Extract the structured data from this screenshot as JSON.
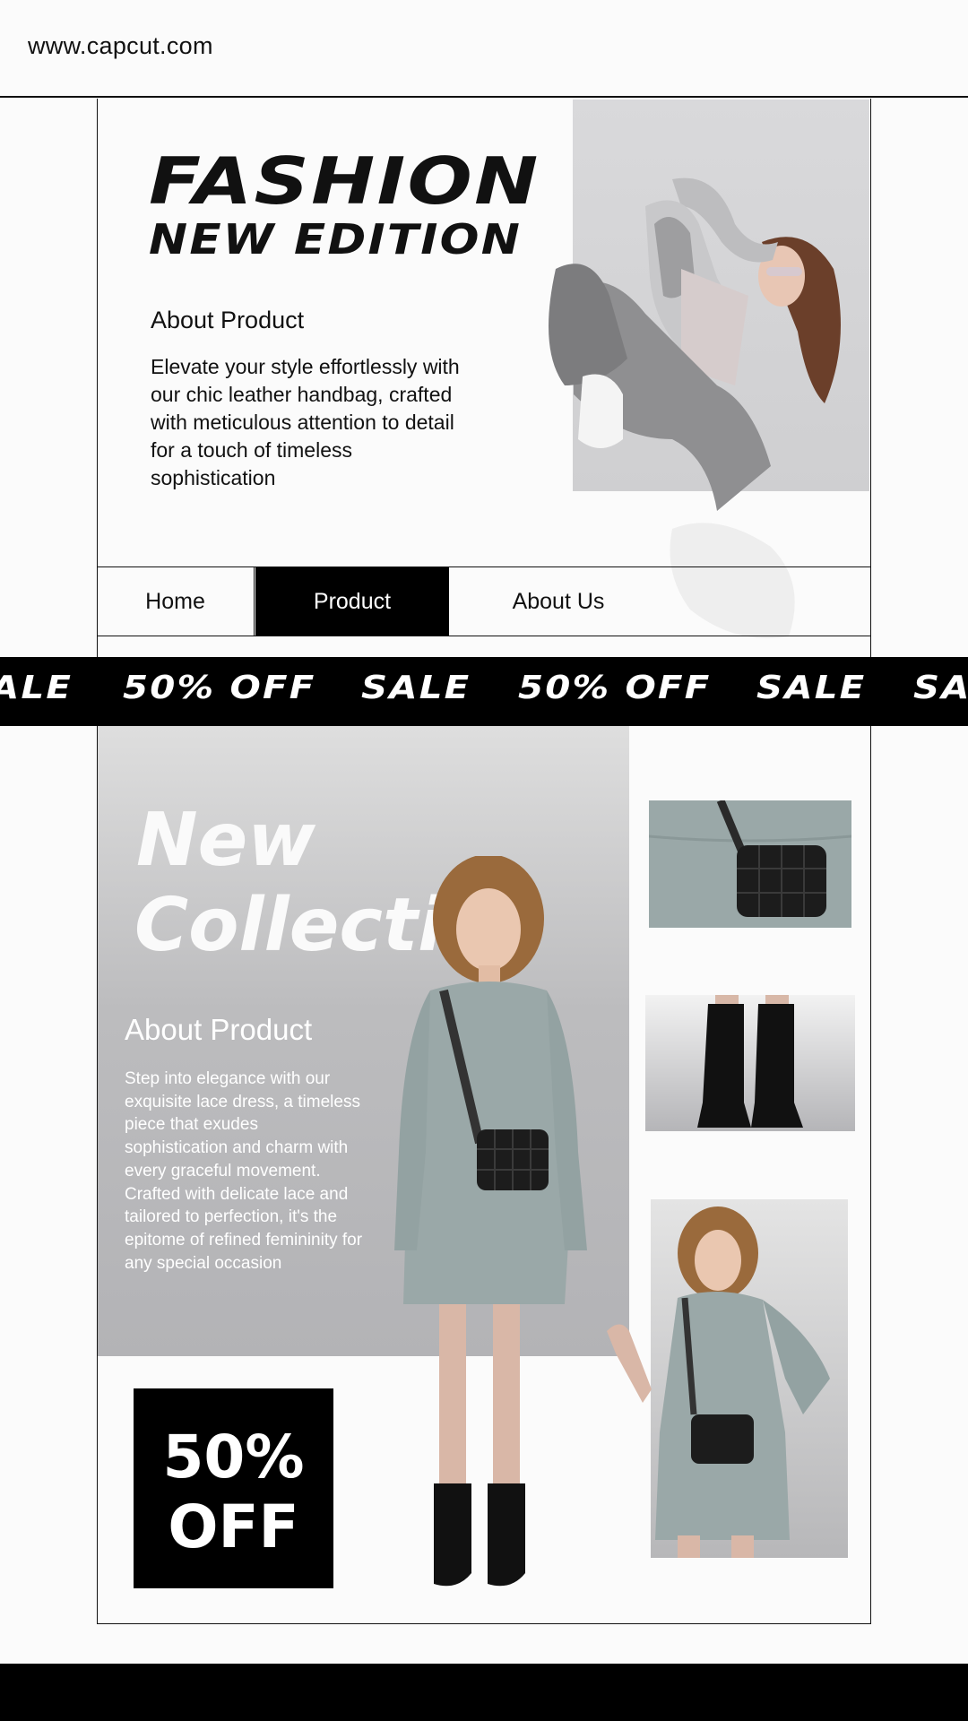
{
  "header": {
    "url": "www.capcut.com"
  },
  "hero": {
    "title_line1": "FASHION",
    "title_line2": "NEW EDITION",
    "about_heading": "About Product",
    "about_text": "Elevate your style effortlessly with\nour chic leather handbag, crafted\nwith meticulous attention to detail\n for a touch of timeless\nsophistication"
  },
  "nav": {
    "items": [
      {
        "label": "Home"
      },
      {
        "label": "Product",
        "active": true
      },
      {
        "label": "About Us"
      }
    ]
  },
  "ticker": {
    "items": [
      "ALE",
      "50% OFF",
      "SALE",
      "50% OFF",
      "SALE",
      "SA"
    ]
  },
  "collection": {
    "title_line1": "New",
    "title_line2": "Collection",
    "about_heading": "About Product",
    "about_text": "Step into elegance with our\nexquisite lace dress, a timeless\npiece that exudes\nsophistication and charm with\nevery graceful movement.\nCrafted with delicate lace and\ntailored to perfection, it's the\nepitome of refined femininity for\n any special occasion"
  },
  "promo": {
    "line1": "50%",
    "line2": "OFF"
  },
  "colors": {
    "accent": "#000000",
    "background": "#fbfbfb",
    "dress": "#9aa9a9",
    "panel": "#bcbcbe"
  }
}
